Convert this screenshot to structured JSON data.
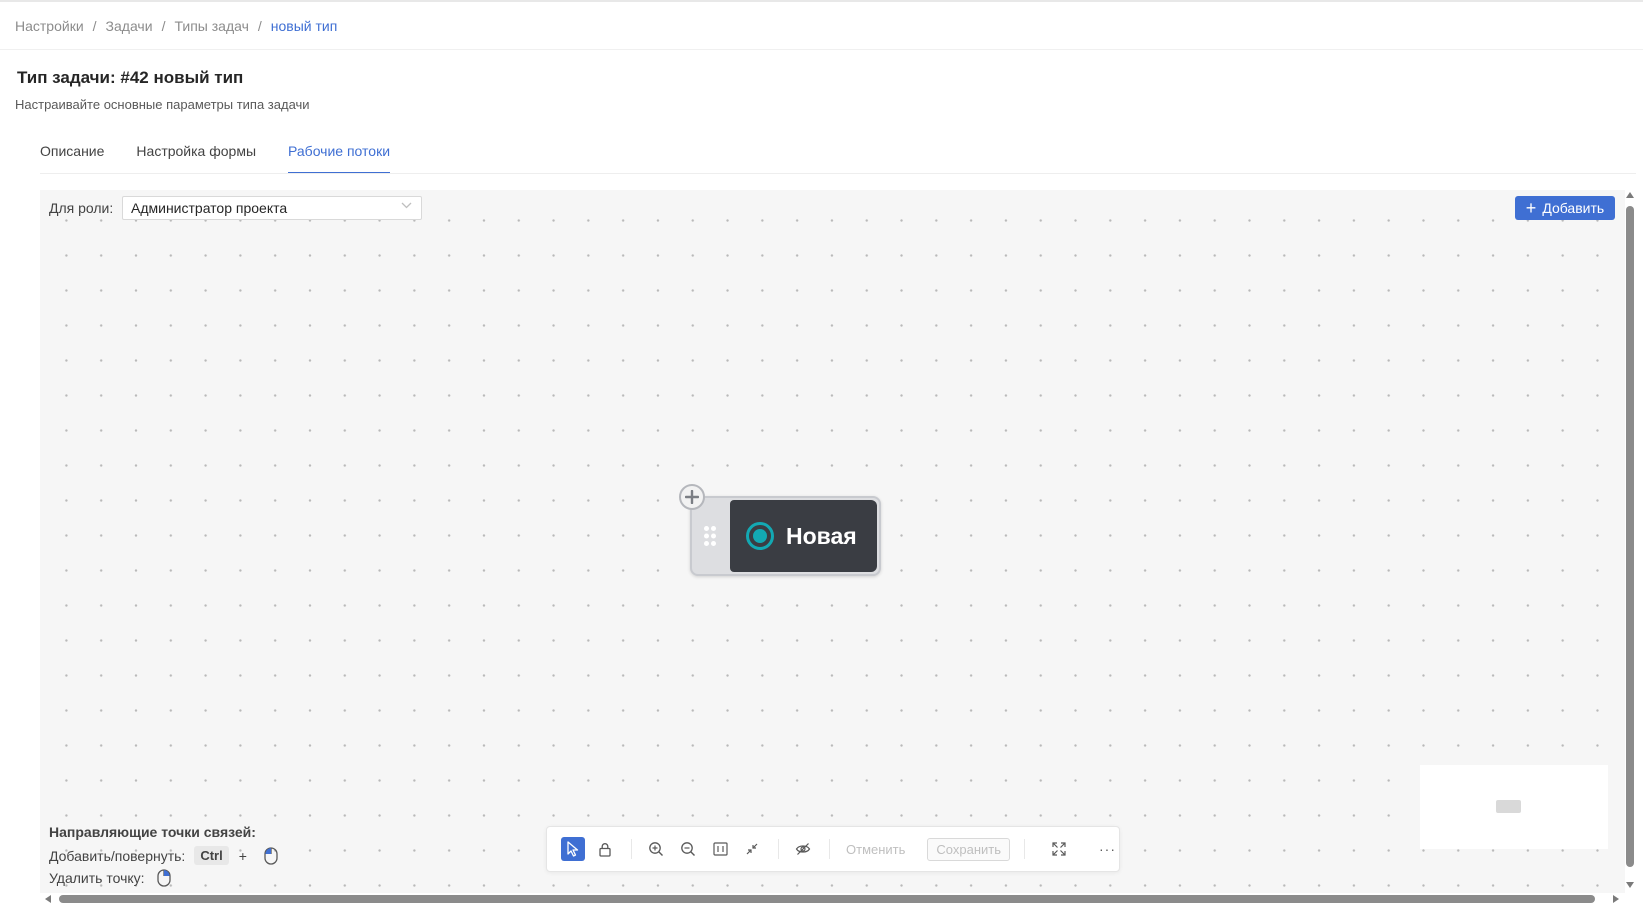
{
  "breadcrumb": [
    {
      "label": "Настройки"
    },
    {
      "label": "Задачи"
    },
    {
      "label": "Типы задач"
    },
    {
      "label": "новый тип"
    }
  ],
  "breadcrumb_separator": "/",
  "page": {
    "title": "Тип задачи: #42 новый тип",
    "subtitle": "Настраивайте основные параметры типа задачи"
  },
  "tabs": [
    {
      "label": "Описание",
      "active": false
    },
    {
      "label": "Настройка формы",
      "active": false
    },
    {
      "label": "Рабочие потоки",
      "active": true
    }
  ],
  "workflow": {
    "role_label": "Для роли:",
    "role_value": "Администратор проекта",
    "add_button": "Добавить",
    "node": {
      "label": "Новая",
      "status_color": "#13a9b3"
    },
    "guide": {
      "title": "Направляющие точки связей:",
      "add_rotate_label": "Добавить/повернуть:",
      "key": "Ctrl",
      "plus": "+",
      "delete_label": "Удалить точку:"
    },
    "toolbar": {
      "cancel": "Отменить",
      "save": "Сохранить",
      "more": "···"
    }
  },
  "colors": {
    "accent": "#3f6fd3",
    "node_bg": "#3a3d43",
    "canvas_bg": "#f6f6f6"
  },
  "icons": [
    "pointer-icon",
    "lock-icon",
    "zoom-in-icon",
    "zoom-out-icon",
    "fit-view-icon",
    "shrink-icon",
    "hide-icon",
    "fullscreen-icon",
    "more-icon",
    "mouse-icon",
    "drag-handle-icon",
    "plus-icon",
    "chevron-down-icon"
  ]
}
